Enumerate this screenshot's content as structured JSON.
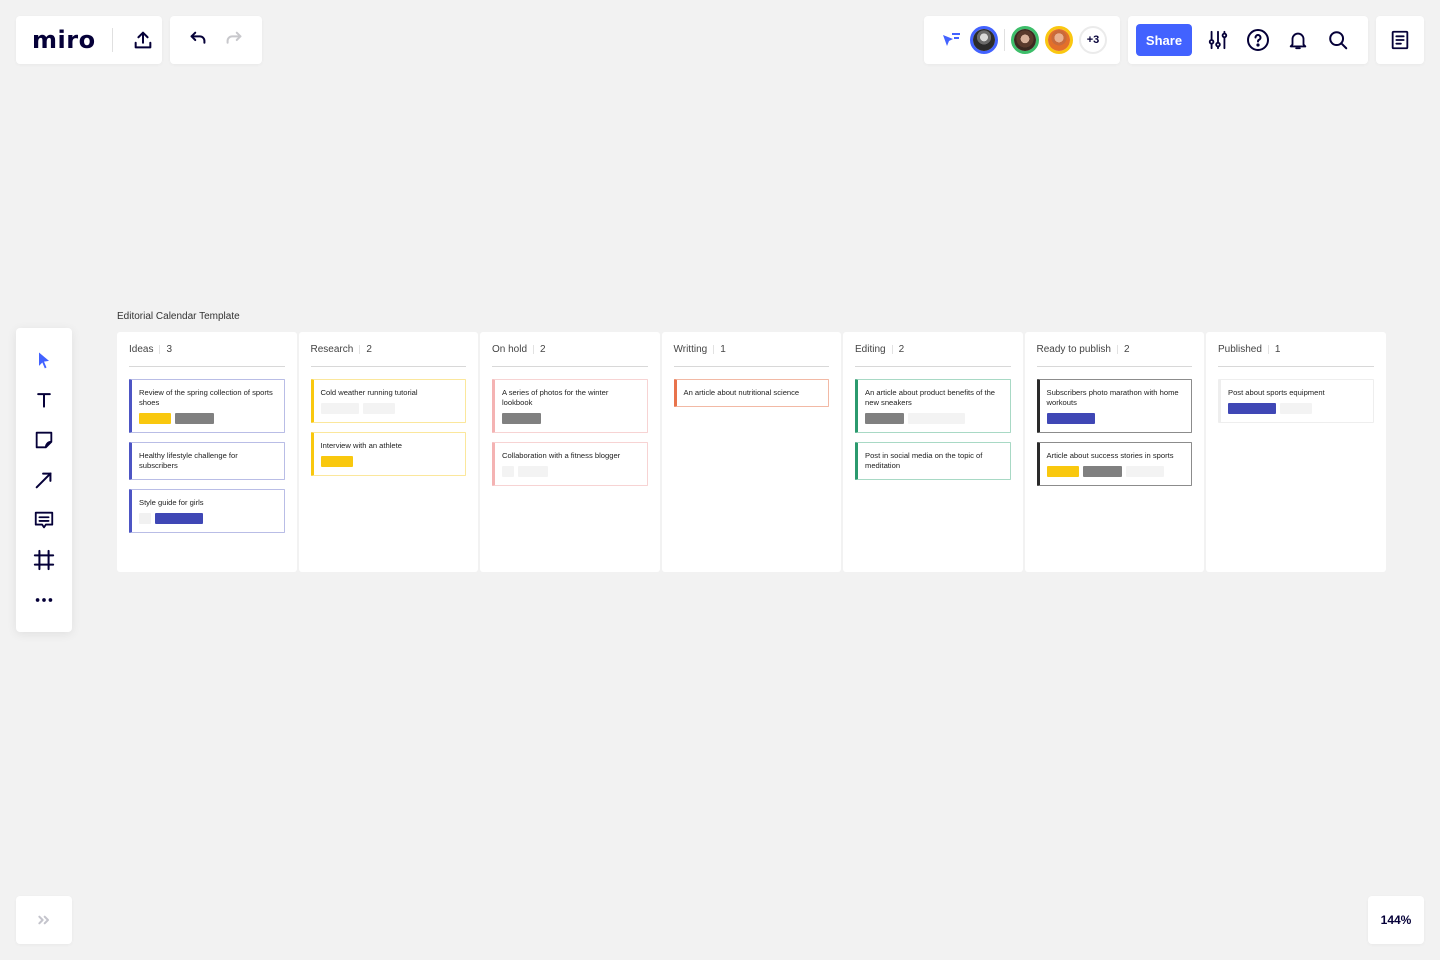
{
  "app": {
    "logo": "miro"
  },
  "header": {
    "share_label": "Share",
    "extra_collaborators": "+3"
  },
  "zoom_level": "144%",
  "frame": {
    "title": "Editorial Calendar Template"
  },
  "colors": {
    "accent": "#4262ff",
    "yellow": "#f9c80e",
    "gray": "#808080",
    "light": "#f1f1f1",
    "indigo": "#3f47b5"
  },
  "columns": [
    {
      "title": "Ideas",
      "count": "3",
      "accent": "#4d55c4",
      "border": "#b9bde6",
      "cards": [
        {
          "text": "Review of the spring collection of sports shoes",
          "tags": [
            {
              "color": "#f9c80e",
              "w": 32
            },
            {
              "color": "#808080",
              "w": 39
            }
          ]
        },
        {
          "text": "Healthy lifestyle challenge for subscribers",
          "tags": []
        },
        {
          "text": "Style guide for girls",
          "tags": [
            {
              "color": "#f1f1f1",
              "w": 12
            },
            {
              "color": "#3f47b5",
              "w": 48
            }
          ]
        }
      ]
    },
    {
      "title": "Research",
      "count": "2",
      "accent": "#f9c80e",
      "border": "#fbe79c",
      "cards": [
        {
          "text": "Cold weather running tutorial",
          "tags": [
            {
              "color": "#f3f3f3",
              "w": 38
            },
            {
              "color": "#f3f3f3",
              "w": 32
            }
          ]
        },
        {
          "text": "Interview with an athlete",
          "tags": [
            {
              "color": "#f9c80e",
              "w": 32
            }
          ]
        }
      ]
    },
    {
      "title": "On hold",
      "count": "2",
      "accent": "#f4b3b3",
      "border": "#f7d3d3",
      "cards": [
        {
          "text": "A series of photos for the winter lookbook",
          "tags": [
            {
              "color": "#808080",
              "w": 39
            }
          ]
        },
        {
          "text": "Collaboration with a fitness blogger",
          "tags": [
            {
              "color": "#f3f3f3",
              "w": 12
            },
            {
              "color": "#f3f3f3",
              "w": 30
            }
          ]
        }
      ]
    },
    {
      "title": "Writting",
      "count": "1",
      "accent": "#e8734c",
      "border": "#f2b9a5",
      "cards": [
        {
          "text": "An article about nutritional science",
          "tags": []
        }
      ]
    },
    {
      "title": "Editing",
      "count": "2",
      "accent": "#2b9a6e",
      "border": "#a8d9c5",
      "cards": [
        {
          "text": "An article about product benefits of the new sneakers",
          "tags": [
            {
              "color": "#808080",
              "w": 39
            },
            {
              "color": "#f3f3f3",
              "w": 57
            }
          ]
        },
        {
          "text": "Post in social media on the topic of meditation",
          "tags": []
        }
      ]
    },
    {
      "title": "Ready to publish",
      "count": "2",
      "accent": "#2a2a2a",
      "border": "#8c8c8c",
      "cards": [
        {
          "text": "Subscribers photo marathon with home workouts",
          "tags": [
            {
              "color": "#3f47b5",
              "w": 48
            }
          ]
        },
        {
          "text": "Article about success stories in sports",
          "tags": [
            {
              "color": "#f9c80e",
              "w": 32
            },
            {
              "color": "#808080",
              "w": 39
            },
            {
              "color": "#f3f3f3",
              "w": 38
            }
          ]
        }
      ]
    },
    {
      "title": "Published",
      "count": "1",
      "accent": "#eeeeee",
      "border": "#eeeeee",
      "cards": [
        {
          "text": "Post about sports equipment",
          "tags": [
            {
              "color": "#3f47b5",
              "w": 48
            },
            {
              "color": "#f3f3f3",
              "w": 32
            }
          ]
        }
      ]
    }
  ]
}
